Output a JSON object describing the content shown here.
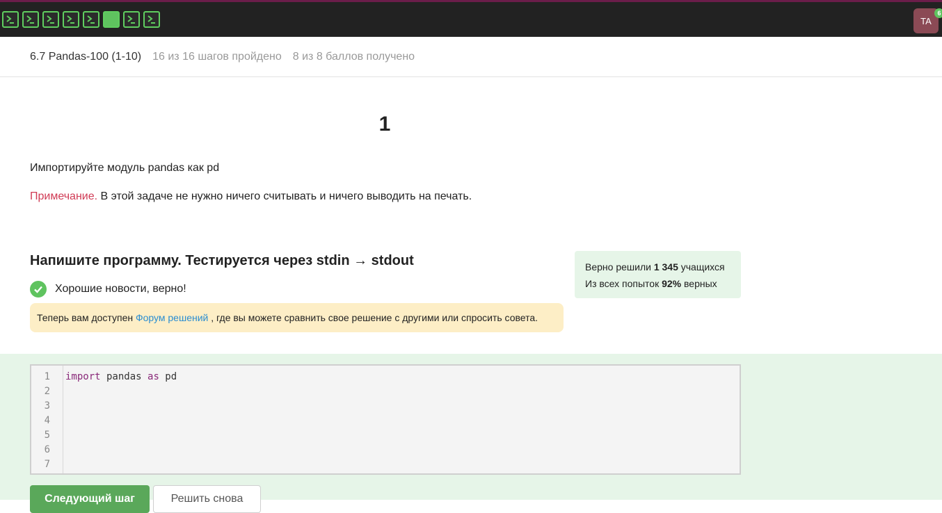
{
  "topbar": {
    "steps": [
      {
        "state": "solved",
        "icon": "terminal-icon"
      },
      {
        "state": "solved",
        "icon": "terminal-icon"
      },
      {
        "state": "solved",
        "icon": "terminal-icon"
      },
      {
        "state": "solved",
        "icon": "terminal-icon"
      },
      {
        "state": "solved",
        "icon": "terminal-icon"
      },
      {
        "state": "current",
        "icon": ""
      },
      {
        "state": "solved",
        "icon": "terminal-icon"
      },
      {
        "state": "solved",
        "icon": "terminal-icon"
      }
    ],
    "avatar_initials": "TA",
    "notification_count": "6"
  },
  "lesson": {
    "title": "6.7 Pandas-100 (1-10)",
    "progress": "16 из 16 шагов пройдено",
    "score": "8 из 8 баллов  получено"
  },
  "step": {
    "number": "1",
    "task_text": "Импортируйте модуль pandas как pd",
    "note_label": "Примечание.",
    "note_text": " В этой задаче не нужно ничего считывать и ничего выводить на печать."
  },
  "exercise": {
    "title": "Напишите программу. Тестируется через stdin → stdout",
    "result_text": "Хорошие новости, верно!",
    "forum_prefix": "Теперь вам доступен ",
    "forum_link": "Форум решений",
    "forum_suffix": " , где вы можете сравнить свое решение с другими или спросить совета."
  },
  "stats": {
    "solved_prefix": "Верно решили ",
    "solved_count": "1 345",
    "solved_suffix": " учащихся",
    "attempts_prefix": "Из всех попыток ",
    "attempts_percent": "92%",
    "attempts_suffix": " верных"
  },
  "editor": {
    "line_numbers": [
      "1",
      "2",
      "3",
      "4",
      "5",
      "6",
      "7"
    ],
    "line1_kw1": "import",
    "line1_mid": " pandas ",
    "line1_kw2": "as",
    "line1_end": " pd"
  },
  "buttons": {
    "next_step": "Следующий шаг",
    "solve_again": "Решить снова"
  },
  "colors": {
    "accent_green": "#5fc35f",
    "note_red": "#d03b55",
    "link_blue": "#2a8dd1"
  }
}
